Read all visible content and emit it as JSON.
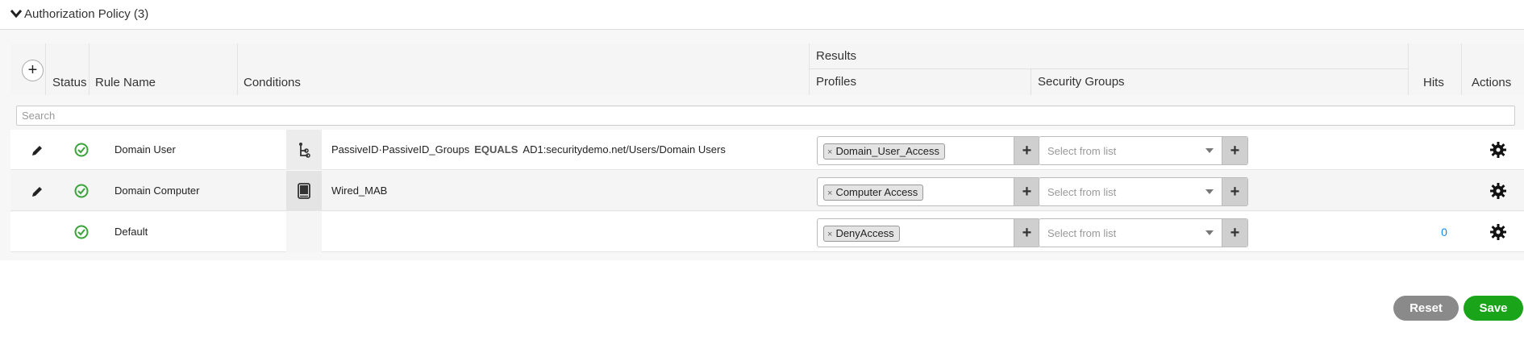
{
  "section": {
    "title": "Authorization Policy (3)"
  },
  "table": {
    "columns": {
      "status": "Status",
      "rule_name": "Rule Name",
      "conditions": "Conditions",
      "results": "Results",
      "profiles": "Profiles",
      "security_groups": "Security Groups",
      "hits": "Hits",
      "actions": "Actions"
    },
    "search_placeholder": "Search",
    "rows": [
      {
        "rule_name": "Domain User",
        "condition_attr": "PassiveID·PassiveID_Groups",
        "condition_op": "EQUALS",
        "condition_value": "AD1:securitydemo.net/Users/Domain Users",
        "profile_tag": "Domain_User_Access",
        "security_group_placeholder": "Select from list",
        "hits": ""
      },
      {
        "rule_name": "Domain Computer",
        "condition_attr": "Wired_MAB",
        "condition_op": "",
        "condition_value": "",
        "profile_tag": "Computer Access",
        "security_group_placeholder": "Select from list",
        "hits": ""
      },
      {
        "rule_name": "Default",
        "condition_attr": "",
        "condition_op": "",
        "condition_value": "",
        "profile_tag": "DenyAccess",
        "security_group_placeholder": "Select from list",
        "hits": "0"
      }
    ]
  },
  "buttons": {
    "reset": "Reset",
    "save": "Save"
  },
  "colors": {
    "status_ok": "#3aa33a",
    "hits_link": "#1e88e5",
    "save": "#19a419",
    "reset": "#8a8a8a"
  },
  "icons": {
    "collapse": "chevron-down-icon",
    "add": "plus-circle-icon",
    "edit": "pencil-icon",
    "status": "check-circle-icon",
    "identity_condition": "identity-group-icon",
    "library_condition": "library-book-icon",
    "actions": "gear-icon"
  }
}
